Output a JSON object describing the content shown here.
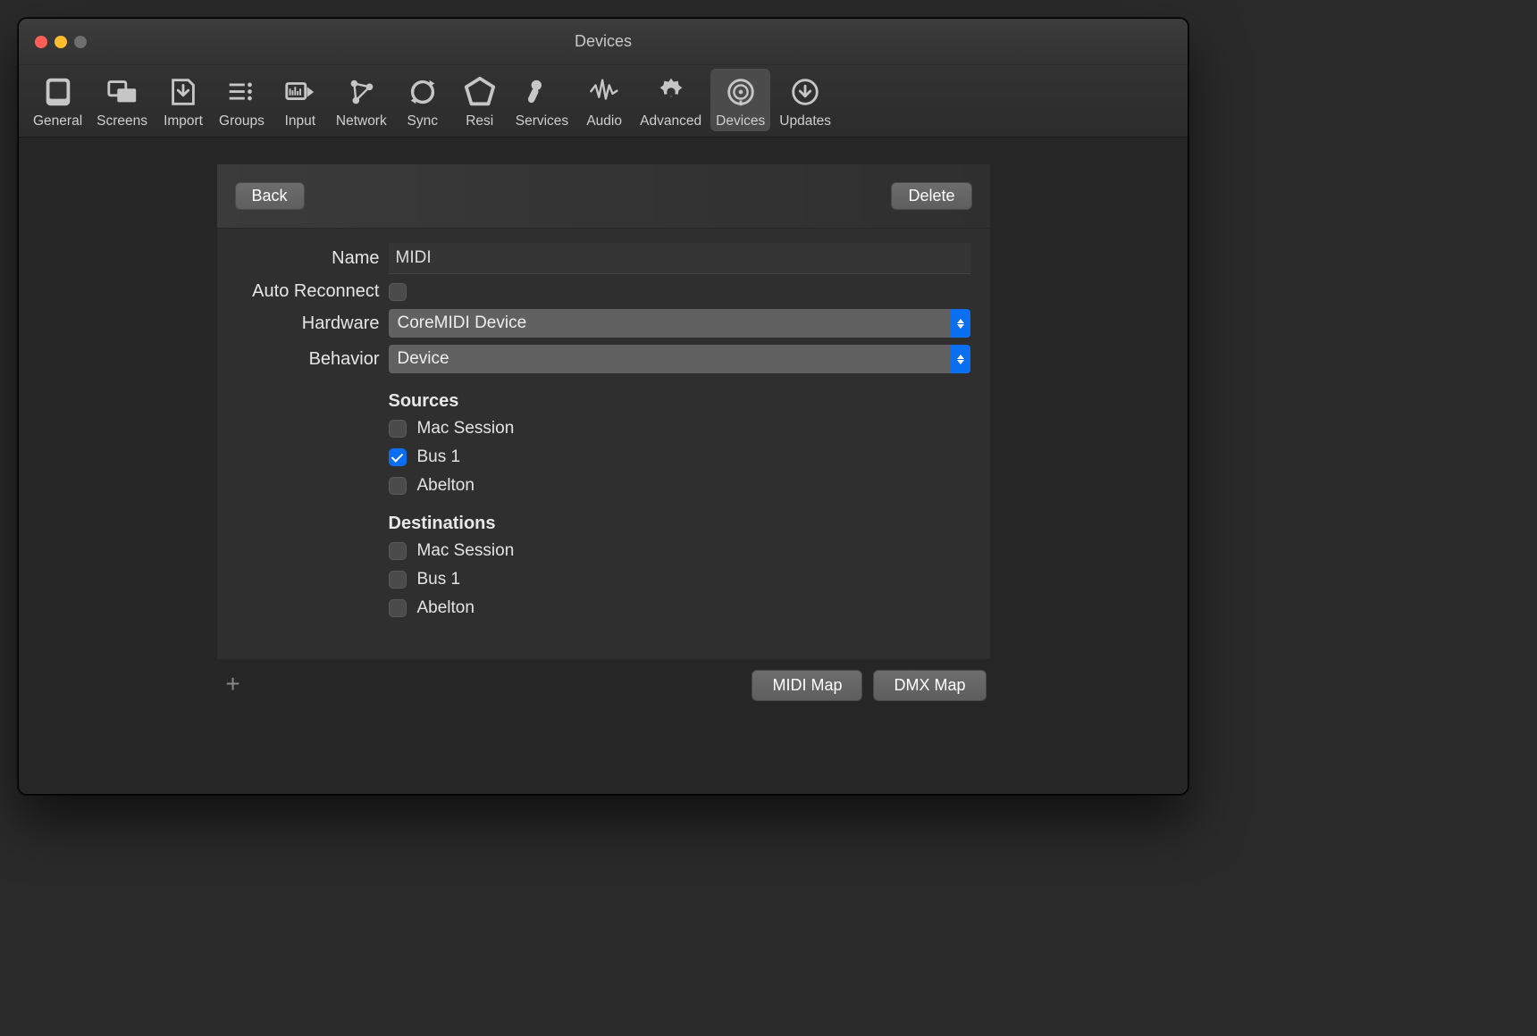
{
  "window": {
    "title": "Devices"
  },
  "toolbar": {
    "items": [
      {
        "label": "General"
      },
      {
        "label": "Screens"
      },
      {
        "label": "Import"
      },
      {
        "label": "Groups"
      },
      {
        "label": "Input"
      },
      {
        "label": "Network"
      },
      {
        "label": "Sync"
      },
      {
        "label": "Resi"
      },
      {
        "label": "Services"
      },
      {
        "label": "Audio"
      },
      {
        "label": "Advanced"
      },
      {
        "label": "Devices"
      },
      {
        "label": "Updates"
      }
    ]
  },
  "head": {
    "back": "Back",
    "delete": "Delete"
  },
  "form": {
    "name_label": "Name",
    "name_value": "MIDI",
    "auto_reconnect_label": "Auto Reconnect",
    "auto_reconnect_checked": false,
    "hardware_label": "Hardware",
    "hardware_value": "CoreMIDI Device",
    "behavior_label": "Behavior",
    "behavior_value": "Device",
    "sources_title": "Sources",
    "sources": [
      {
        "label": "Mac Session",
        "checked": false
      },
      {
        "label": "Bus 1",
        "checked": true
      },
      {
        "label": "Abelton",
        "checked": false
      }
    ],
    "destinations_title": "Destinations",
    "destinations": [
      {
        "label": "Mac Session",
        "checked": false
      },
      {
        "label": "Bus 1",
        "checked": false
      },
      {
        "label": "Abelton",
        "checked": false
      }
    ]
  },
  "footer": {
    "add": "+",
    "midi_map": "MIDI Map",
    "dmx_map": "DMX Map"
  }
}
